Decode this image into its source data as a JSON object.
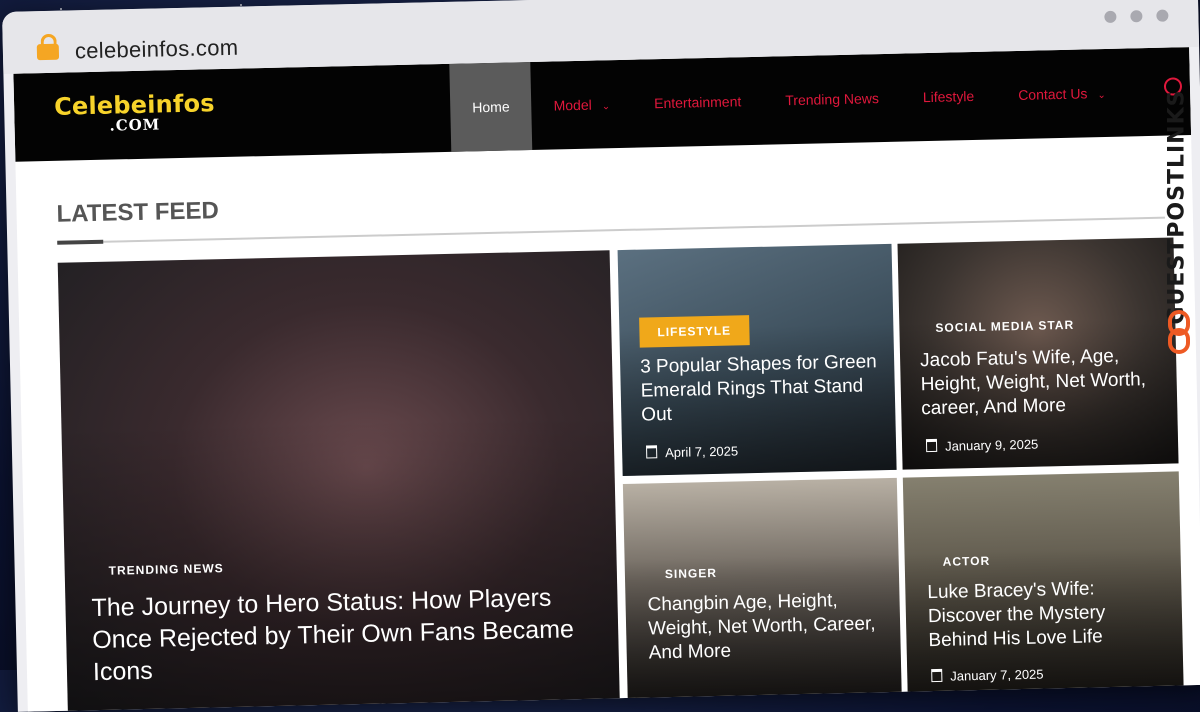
{
  "browser": {
    "url": "celebeinfos.com"
  },
  "site": {
    "logo": {
      "line1": "Celebeinfos",
      "line2": ".COM"
    },
    "nav": {
      "items": [
        {
          "label": "Home",
          "active": true,
          "dropdown": false
        },
        {
          "label": "Model",
          "active": false,
          "dropdown": true
        },
        {
          "label": "Entertainment",
          "active": false,
          "dropdown": false
        },
        {
          "label": "Trending News",
          "active": false,
          "dropdown": false
        },
        {
          "label": "Lifestyle",
          "active": false,
          "dropdown": false
        },
        {
          "label": "Contact Us",
          "active": false,
          "dropdown": true
        }
      ],
      "search_icon": "search-icon"
    },
    "colors": {
      "accent": "#e0183c",
      "logo_yellow": "#f7d32a",
      "badge": "#f0a81a",
      "nav_bg": "#030303"
    }
  },
  "feed": {
    "title": "LATEST FEED",
    "featured": {
      "category": "TRENDING NEWS",
      "title": "The Journey to Hero Status: How Players Once Rejected by Their Own Fans Became Icons"
    },
    "cards": [
      {
        "category": "LIFESTYLE",
        "title": "3 Popular Shapes for Green Emerald Rings That Stand Out",
        "date": "April 7, 2025"
      },
      {
        "category": "SOCIAL MEDIA STAR",
        "title": "Jacob Fatu's Wife, Age, Height, Weight, Net Worth, career, And More",
        "date": "January 9, 2025"
      },
      {
        "category": "SINGER",
        "title": "Changbin Age, Height, Weight, Net Worth, Career, And More",
        "date": ""
      },
      {
        "category": "ACTOR",
        "title": "Luke Bracey's Wife: Discover the Mystery Behind His Love Life",
        "date": "January 7, 2025"
      }
    ]
  },
  "watermark": {
    "text": "GUESTPOSTLINKS"
  }
}
